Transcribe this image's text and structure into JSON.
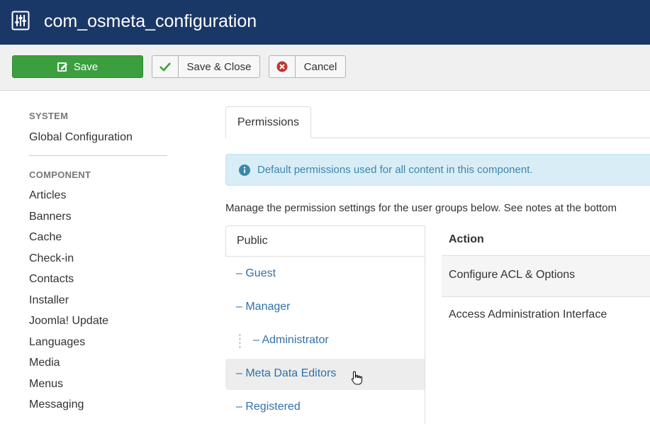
{
  "header": {
    "title": "com_osmeta_configuration",
    "icon": "sliders-icon"
  },
  "toolbar": {
    "save_label": "Save",
    "save_close_label": "Save & Close",
    "cancel_label": "Cancel"
  },
  "sidebar": {
    "system_heading": "SYSTEM",
    "global_config": "Global Configuration",
    "component_heading": "COMPONENT",
    "items": [
      "Articles",
      "Banners",
      "Cache",
      "Check-in",
      "Contacts",
      "Installer",
      "Joomla! Update",
      "Languages",
      "Media",
      "Menus",
      "Messaging"
    ]
  },
  "tabs": {
    "permissions": "Permissions"
  },
  "alert": {
    "text": "Default permissions used for all content in this component.",
    "icon": "info-icon"
  },
  "manage_text": "Manage the permission settings for the user groups below. See notes at the bottom",
  "groups": {
    "public": "Public",
    "guest": "– Guest",
    "manager": "– Manager",
    "administrator": "– Administrator",
    "meta_editors": "– Meta Data Editors",
    "registered": "– Registered"
  },
  "actions": {
    "header": "Action",
    "row1": "Configure ACL & Options",
    "row2": "Access Administration Interface"
  },
  "colors": {
    "header_bg": "#1a3867",
    "save_green": "#3c9f3f",
    "link_blue": "#3071a9",
    "alert_bg": "#d9edf7"
  }
}
